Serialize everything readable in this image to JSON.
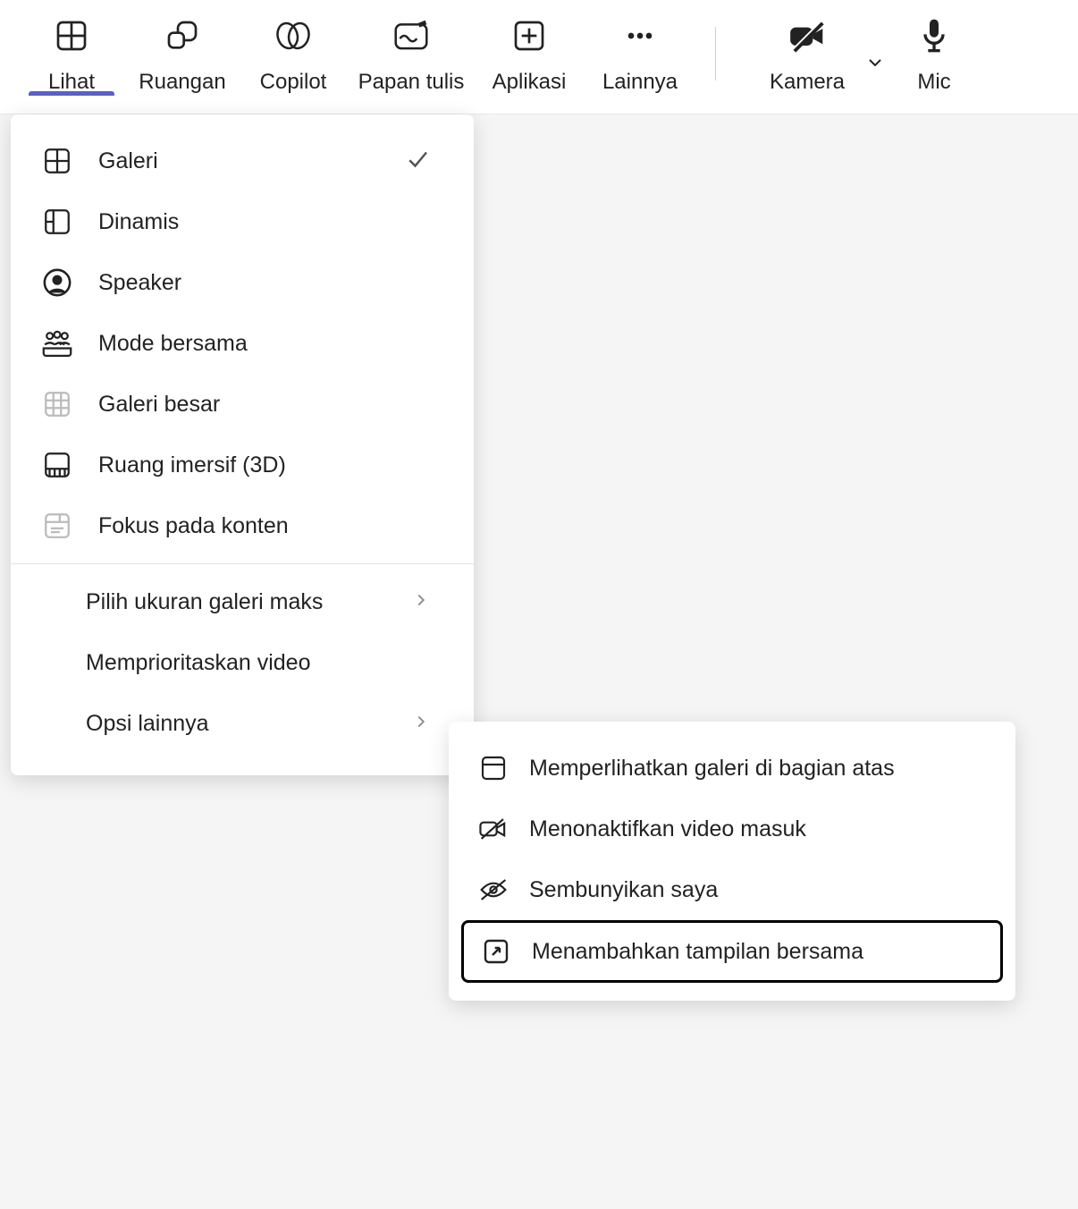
{
  "toolbar": {
    "items": [
      {
        "label": "Lihat",
        "icon": "grid-icon",
        "active": true
      },
      {
        "label": "Ruangan",
        "icon": "rooms-icon"
      },
      {
        "label": "Copilot",
        "icon": "copilot-icon"
      },
      {
        "label": "Papan tulis",
        "icon": "whiteboard-icon"
      },
      {
        "label": "Aplikasi",
        "icon": "apps-icon"
      },
      {
        "label": "Lainnya",
        "icon": "more-icon"
      },
      {
        "label": "Kamera",
        "icon": "camera-off-icon",
        "chevron": true
      },
      {
        "label": "Mic",
        "icon": "mic-icon"
      }
    ]
  },
  "viewMenu": {
    "items": [
      {
        "label": "Galeri",
        "icon": "grid-icon",
        "checked": true
      },
      {
        "label": "Dinamis",
        "icon": "dynamic-icon"
      },
      {
        "label": "Speaker",
        "icon": "speaker-icon"
      },
      {
        "label": "Mode bersama",
        "icon": "together-icon"
      },
      {
        "label": "Galeri besar",
        "icon": "large-gallery-icon"
      },
      {
        "label": "Ruang imersif (3D)",
        "icon": "immersive-icon"
      },
      {
        "label": "Fokus pada konten",
        "icon": "content-focus-icon"
      }
    ],
    "options": [
      {
        "label": "Pilih ukuran galeri maks",
        "submenu": true
      },
      {
        "label": "Memprioritaskan video"
      },
      {
        "label": "Opsi lainnya",
        "submenu": true
      }
    ]
  },
  "moreOptions": {
    "items": [
      {
        "label": "Memperlihatkan galeri di bagian atas",
        "icon": "gallery-top-icon"
      },
      {
        "label": "Menonaktifkan video masuk",
        "icon": "video-off-icon"
      },
      {
        "label": "Sembunyikan saya",
        "icon": "hide-me-icon"
      },
      {
        "label": "Menambahkan tampilan bersama",
        "icon": "companion-icon",
        "highlight": true
      }
    ]
  }
}
